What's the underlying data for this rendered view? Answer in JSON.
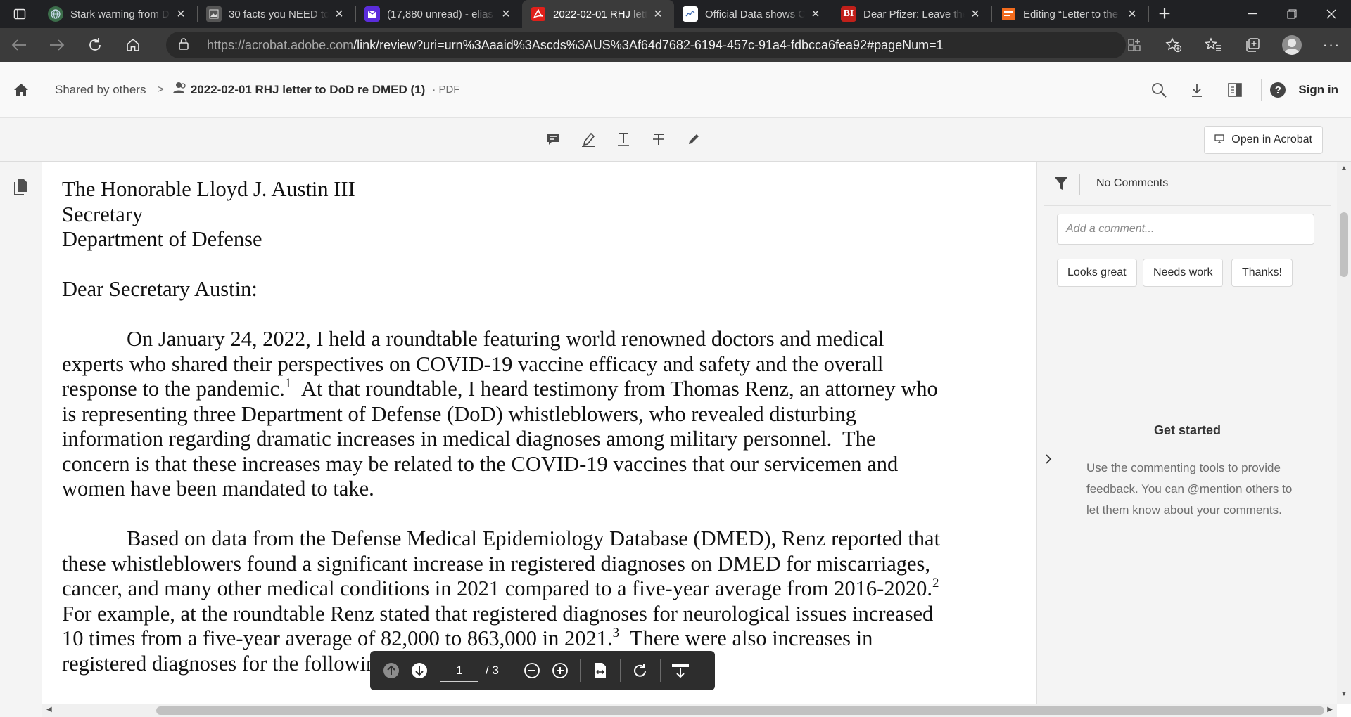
{
  "browser": {
    "tabs": [
      {
        "title": "Stark warning from Dr",
        "favicon_color": "#3c6e4b",
        "favicon_glyph": "globe-icon"
      },
      {
        "title": "30 facts you NEED to k",
        "favicon_color": "#555555",
        "favicon_glyph": "image-icon"
      },
      {
        "title": "(17,880 unread) - elias",
        "favicon_color": "#5b2ddb",
        "favicon_glyph": "mail-icon"
      },
      {
        "title": "2022-02-01 RHJ letter t",
        "favicon_color": "#e0201a",
        "favicon_glyph": "acrobat-icon",
        "active": true
      },
      {
        "title": "Official Data shows Ch",
        "favicon_color": "#ffffff",
        "favicon_glyph": "chart-icon"
      },
      {
        "title": "Dear Pfizer: Leave the",
        "favicon_color": "#c0201a",
        "favicon_glyph": "BI"
      },
      {
        "title": "Editing “Letter to the S",
        "favicon_color": "#f26b1d",
        "favicon_glyph": "blogger-icon"
      }
    ],
    "url_host": "https://acrobat.adobe.com",
    "url_path": "/link/review?uri=urn%3Aaaid%3Ascds%3AUS%3Af64d7682-6194-457c-91a4-fdbcca6fea92#pageNum=1"
  },
  "header": {
    "breadcrumb_root": "Shared by others",
    "separator": ">",
    "doc_name": "2022-02-01 RHJ letter to DoD re DMED (1)",
    "doc_type": "· PDF",
    "sign_in": "Sign in"
  },
  "toolbar": {
    "open_in_acrobat": "Open in Acrobat"
  },
  "document": {
    "address": [
      "The Honorable Lloyd J. Austin III",
      "Secretary",
      "Department of Defense"
    ],
    "salutation": "Dear Secretary Austin:",
    "p1_a": "On January 24, 2022, I held a roundtable featuring world renowned doctors and medical experts who shared their perspectives on COVID-19 vaccine efficacy and safety and the overall response to the pandemic.",
    "p1_fn": "1",
    "p1_b": "  At that roundtable, I heard testimony from Thomas Renz, an attorney who is representing three Department of Defense (DoD) whistleblowers, who revealed disturbing information regarding dramatic increases in medical diagnoses among military personnel.  The concern is that these increases may be related to the COVID-19 vaccines that our servicemen and women have been mandated to take.",
    "p2_a": "Based on data from the Defense Medical Epidemiology Database (DMED), Renz reported that these whistleblowers found a significant increase in registered diagnoses on DMED for miscarriages, cancer, and many other medical conditions in 2021 compared to a five-year average from 2016-2020.",
    "p2_fn1": "2",
    "p2_b": "  For example, at the roundtable Renz stated that registered diagnoses for neurological issues increased 10 times from a five-year average of 82,000 to 863,000 in 2021.",
    "p2_fn2": "3",
    "p2_c": "  There were also increases in registered diagnoses for the following medical conditions:",
    "p2_fn3": "4"
  },
  "page_controls": {
    "current_page": "1",
    "total_pages": "/ 3"
  },
  "comments": {
    "status": "No Comments",
    "placeholder": "Add a comment...",
    "quick_replies": [
      "Looks great",
      "Needs work",
      "Thanks!"
    ],
    "get_started_title": "Get started",
    "get_started_body": "Use the commenting tools to provide feedback. You can @mention others to let them know about your comments."
  }
}
